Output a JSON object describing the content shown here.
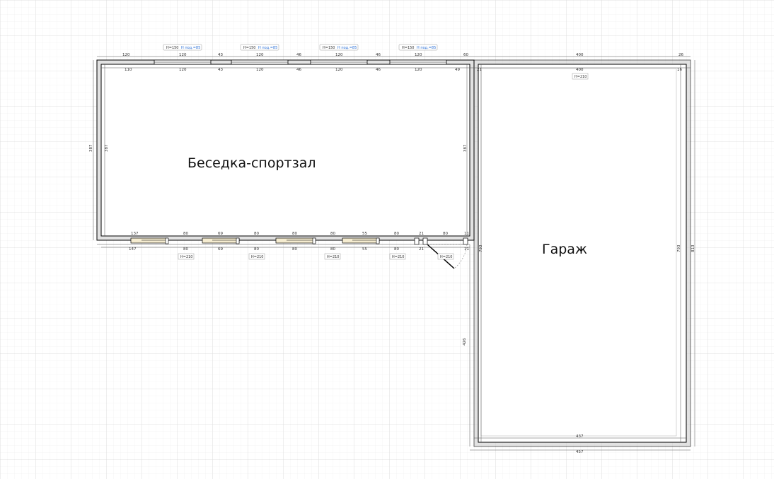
{
  "rooms": {
    "gazebo": {
      "label": "Беседка-спортзал"
    },
    "garage": {
      "label": "Гараж"
    }
  },
  "windows": [
    {
      "height": "H=150",
      "sill": "H под.=85"
    },
    {
      "height": "H=150",
      "sill": "H под.=85"
    },
    {
      "height": "H=150",
      "sill": "H под.=85"
    },
    {
      "height": "H=150",
      "sill": "H под.=85"
    }
  ],
  "doors": [
    {
      "height": "H=210"
    },
    {
      "height": "H=210"
    },
    {
      "height": "H=210"
    },
    {
      "height": "H=210"
    },
    {
      "height": "H=210"
    }
  ],
  "garage_door": {
    "height": "H=210"
  },
  "dimensions": {
    "top_outer": [
      "120",
      "120",
      "43",
      "120",
      "46",
      "120",
      "46",
      "120",
      "60"
    ],
    "top_inner": [
      "110",
      "120",
      "43",
      "120",
      "46",
      "120",
      "46",
      "120",
      "49"
    ],
    "top_right_outer": [
      "400",
      "26"
    ],
    "top_right_inner": [
      "21",
      "400",
      "16"
    ],
    "bottom_inner": [
      "137",
      "80",
      "69",
      "80",
      "80",
      "80",
      "55",
      "80",
      "21",
      "80",
      "11"
    ],
    "bottom_outer": [
      "147",
      "80",
      "69",
      "80",
      "80",
      "80",
      "55",
      "80",
      "21",
      "11"
    ],
    "gazebo_height_outer": "387",
    "gazebo_height_inner": "387",
    "gazebo_height_right": "387",
    "garage_height_left": "793",
    "garage_height_left_lower": "426",
    "garage_height_right_inner": "793",
    "garage_height_right_outer": "813",
    "garage_bottom_inner": "437",
    "garage_bottom_outer": "457"
  }
}
